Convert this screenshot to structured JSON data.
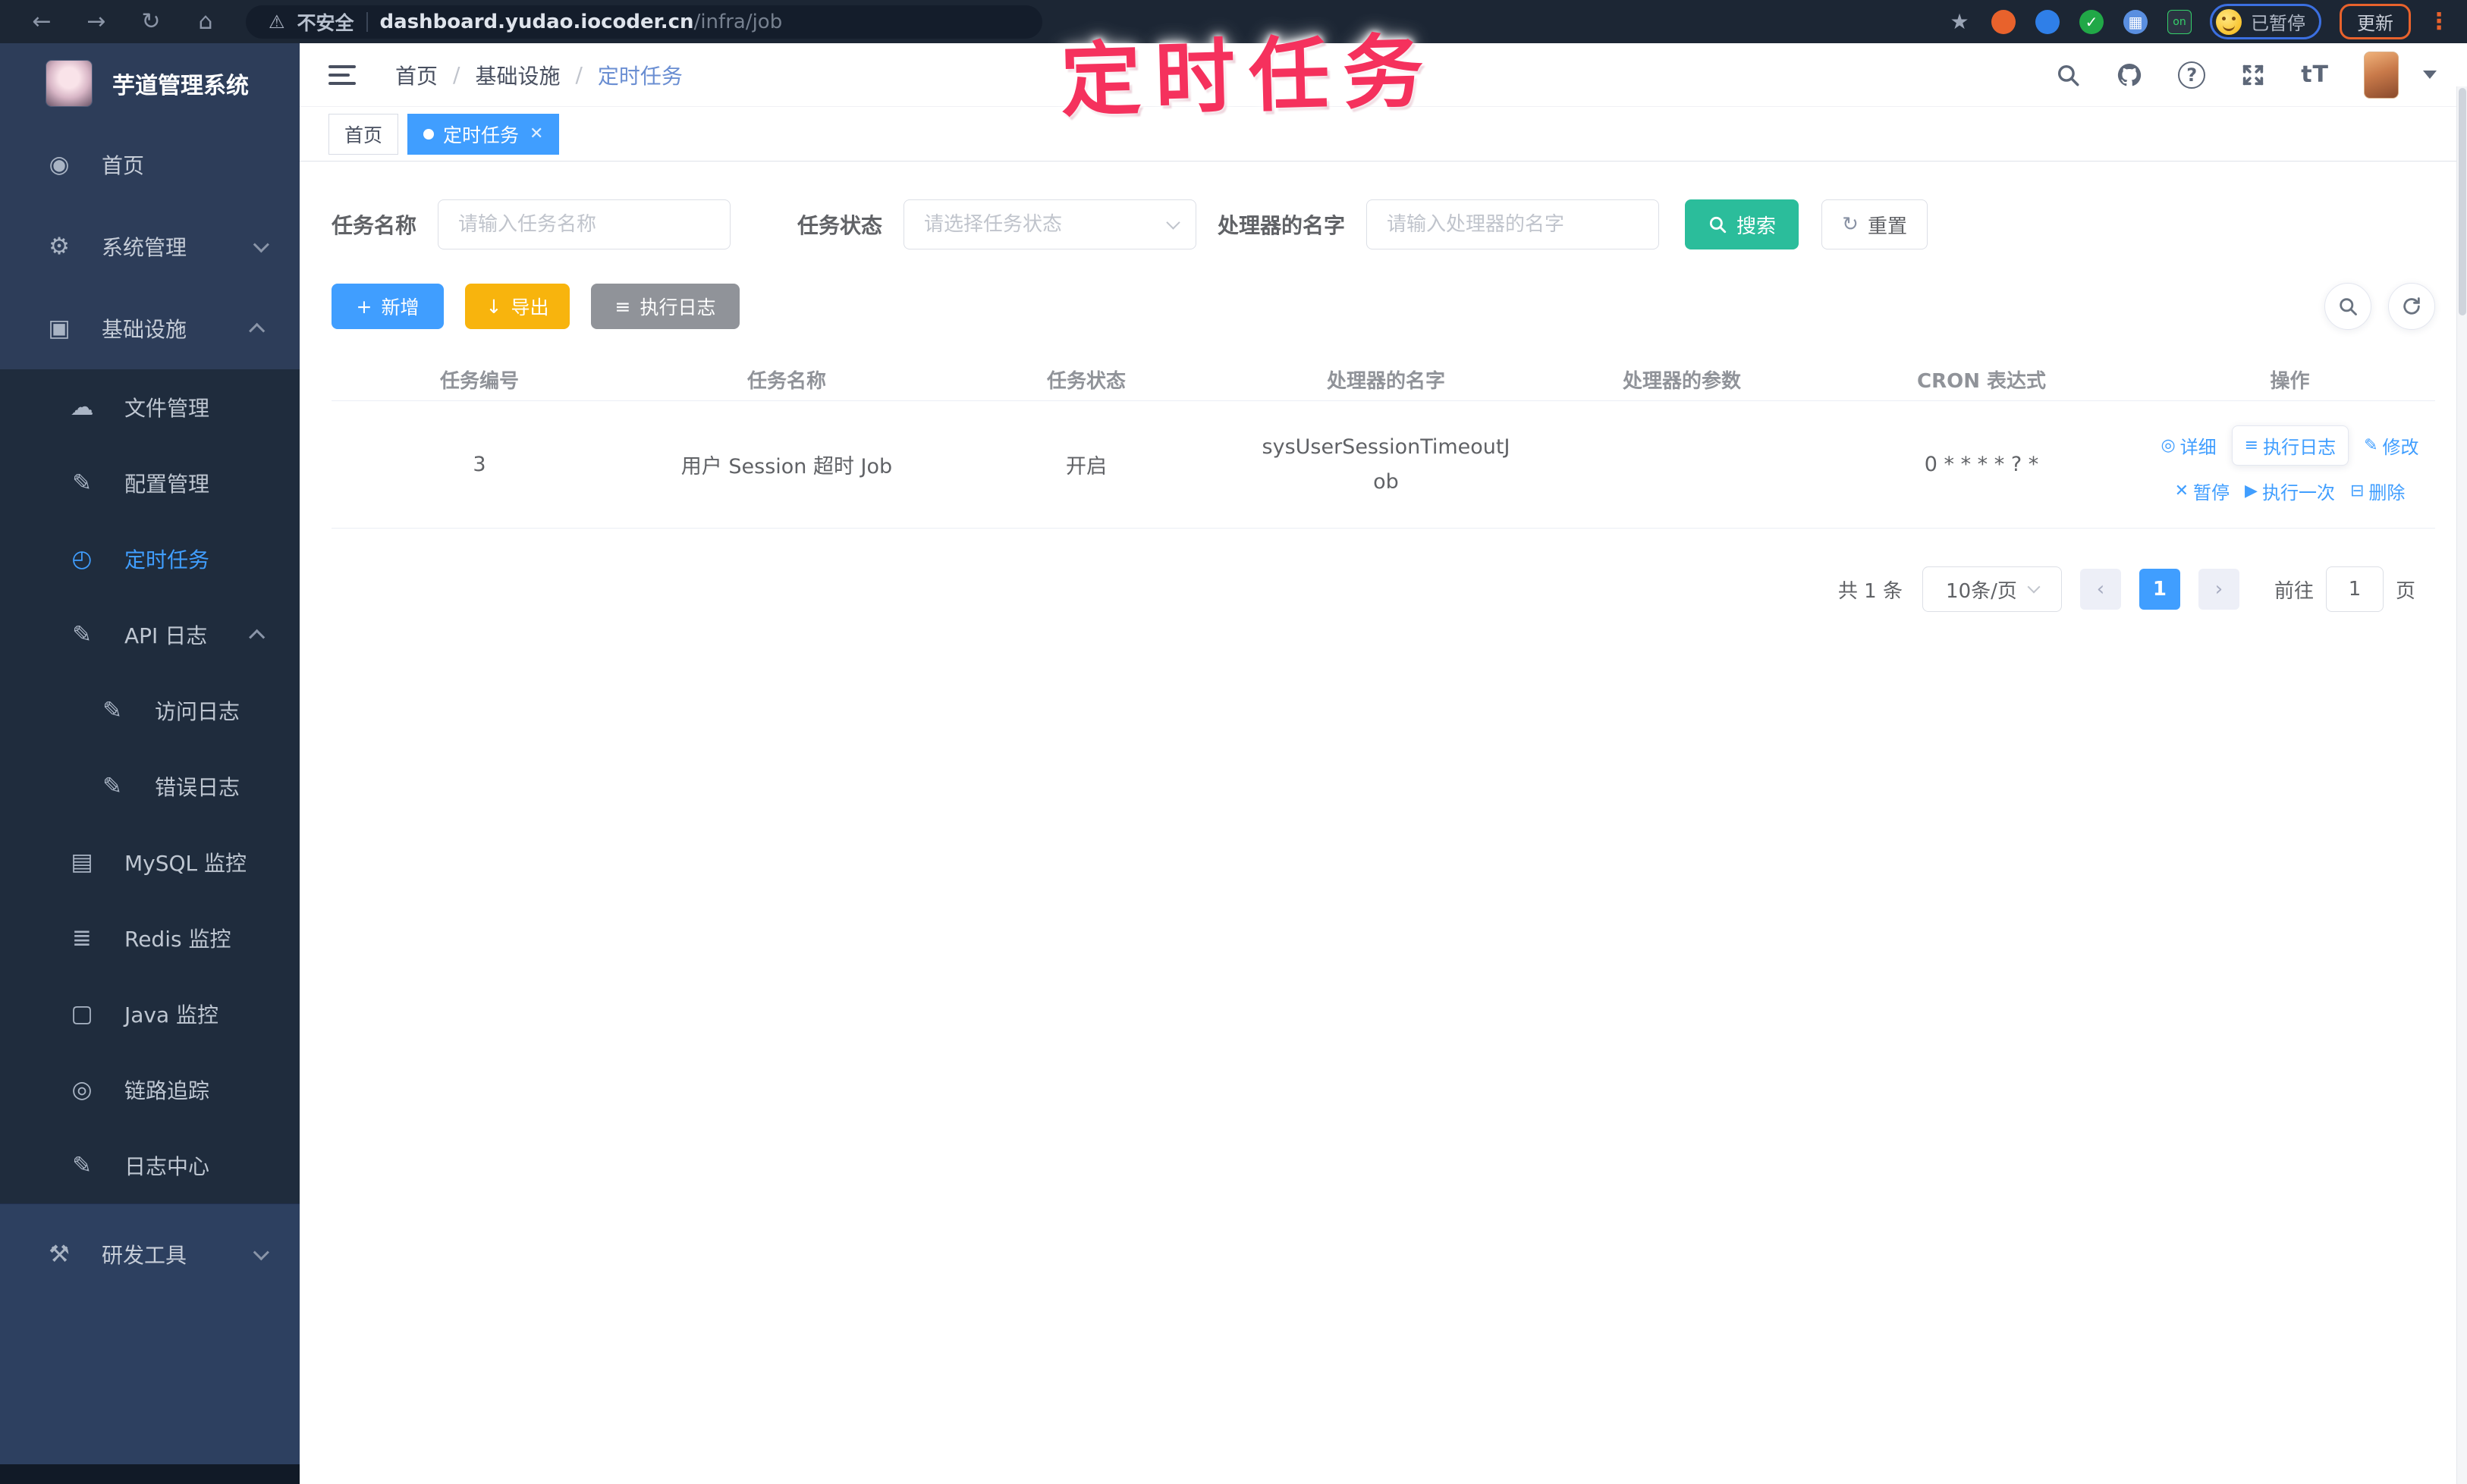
{
  "browser": {
    "security_label": "不安全",
    "url_host": "dashboard.yudao.iocoder.cn",
    "url_path": "/infra/job",
    "paused_badge": "已暂停",
    "update_button": "更新",
    "extension_badge": "on"
  },
  "watermark_text": "定时任务",
  "sidebar": {
    "logo_title": "芋道管理系统",
    "items": [
      {
        "label": "首页"
      },
      {
        "label": "系统管理"
      },
      {
        "label": "基础设施"
      },
      {
        "label": "文件管理"
      },
      {
        "label": "配置管理"
      },
      {
        "label": "定时任务"
      },
      {
        "label": "API 日志"
      },
      {
        "label": "访问日志"
      },
      {
        "label": "错误日志"
      },
      {
        "label": "MySQL 监控"
      },
      {
        "label": "Redis 监控"
      },
      {
        "label": "Java 监控"
      },
      {
        "label": "链路追踪"
      },
      {
        "label": "日志中心"
      },
      {
        "label": "研发工具"
      }
    ]
  },
  "header": {
    "breadcrumb": [
      "首页",
      "基础设施",
      "定时任务"
    ],
    "font_size_icon_label": "tT"
  },
  "tabs": [
    {
      "label": "首页"
    },
    {
      "label": "定时任务"
    }
  ],
  "filters": {
    "name_label": "任务名称",
    "name_placeholder": "请输入任务名称",
    "status_label": "任务状态",
    "status_placeholder": "请选择任务状态",
    "handler_label": "处理器的名字",
    "handler_placeholder": "请输入处理器的名字",
    "search_button": "搜索",
    "reset_button": "重置"
  },
  "toolbar": {
    "add_button": "新增",
    "export_button": "导出",
    "job_log_button": "执行日志"
  },
  "table": {
    "columns": [
      "任务编号",
      "任务名称",
      "任务状态",
      "处理器的名字",
      "处理器的参数",
      "CRON 表达式",
      "操作"
    ],
    "row": {
      "id": "3",
      "name": "用户 Session 超时 Job",
      "status": "开启",
      "handler": "sysUserSessionTimeoutJob",
      "param": "",
      "cron": "0 * * * * ? *",
      "op_detail": "详细",
      "op_log": "执行日志",
      "op_edit": "修改",
      "op_pause": "暂停",
      "op_run_once": "执行一次",
      "op_delete": "删除"
    }
  },
  "pagination": {
    "total": "共 1 条",
    "page_size": "10条/页",
    "current_page": "1",
    "goto_label": "前往",
    "goto_value": "1",
    "goto_suffix": "页"
  },
  "colors": {
    "accent_blue": "#409eff",
    "search_teal": "#2bbd9b",
    "export_amber": "#f8b40d",
    "gray_button": "#909399",
    "watermark_pink": "#f5315d",
    "sidebar_bg": "#2d3d59",
    "submenu_bg": "#1f2c3d"
  }
}
